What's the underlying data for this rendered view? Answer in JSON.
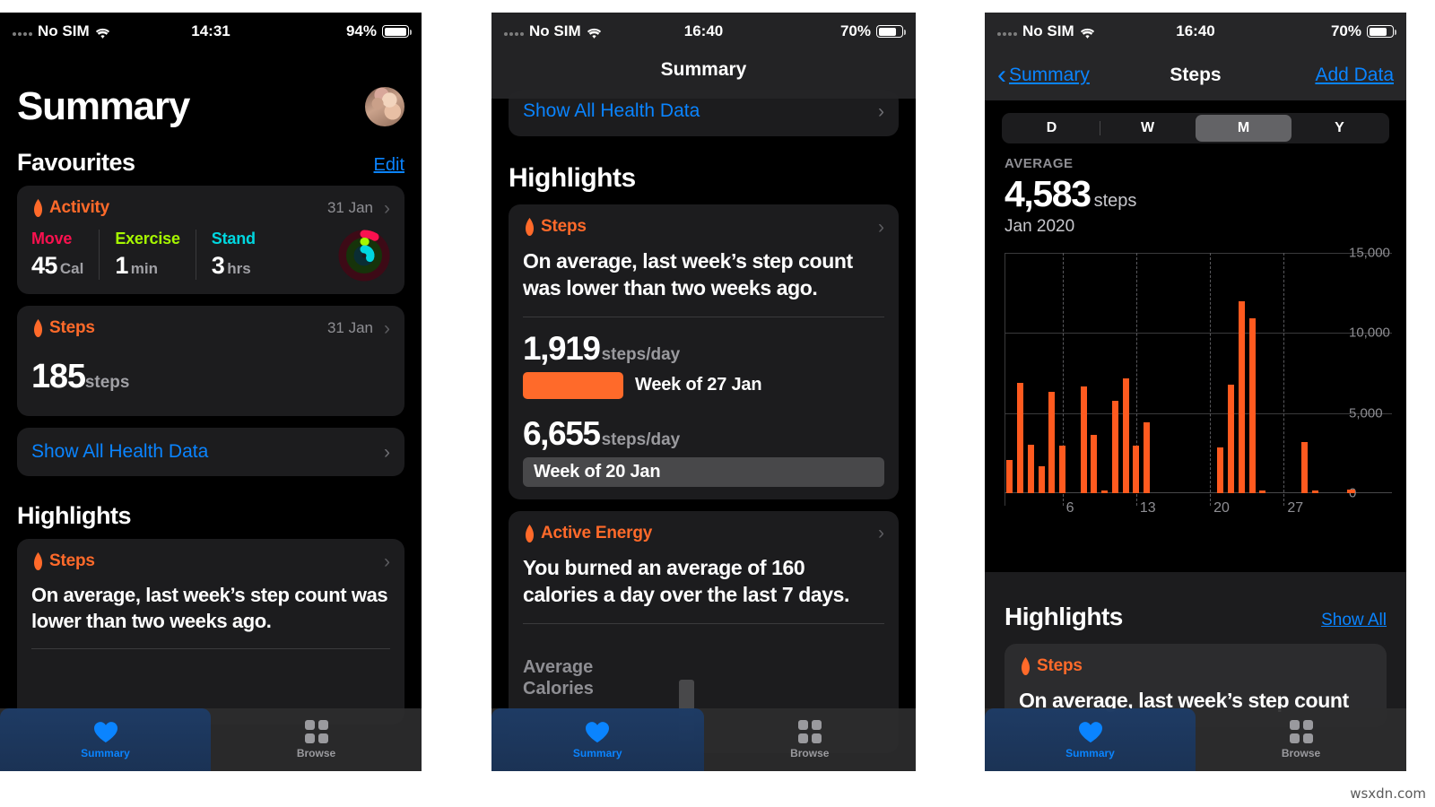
{
  "watermark": "wsxdn.com",
  "panel1": {
    "status": {
      "carrier": "No SIM",
      "time": "14:31",
      "battery": "94%"
    },
    "page_title": "Summary",
    "favourites_label": "Favourites",
    "edit_label": "Edit",
    "activity_card": {
      "title": "Activity",
      "date": "31 Jan",
      "metrics": [
        {
          "label": "Move",
          "value": "45",
          "unit": "Cal",
          "color": "#fa114f"
        },
        {
          "label": "Exercise",
          "value": "1",
          "unit": "min",
          "color": "#a6f700"
        },
        {
          "label": "Stand",
          "value": "3",
          "unit": "hrs",
          "color": "#00d7e0"
        }
      ]
    },
    "steps_card": {
      "title": "Steps",
      "date": "31 Jan",
      "value": "185",
      "unit": "steps"
    },
    "show_all_label": "Show All Health Data",
    "highlights_label": "Highlights",
    "highlight_card": {
      "title": "Steps",
      "body": "On average, last week’s step count was lower than two weeks ago."
    },
    "tabs": [
      {
        "label": "Summary",
        "icon": "heart-icon",
        "selected": true
      },
      {
        "label": "Browse",
        "icon": "grid-icon",
        "selected": false
      }
    ]
  },
  "panel2": {
    "status": {
      "carrier": "No SIM",
      "time": "16:40",
      "battery": "70%"
    },
    "nav_title": "Summary",
    "cut_row_label": "Show All Health Data",
    "highlights_label": "Highlights",
    "steps_card": {
      "title": "Steps",
      "body": "On average, last week’s step count was lower than two weeks ago.",
      "comparison": [
        {
          "value": "1,919",
          "unit": "steps/day",
          "bar_label": "Week of 27 Jan",
          "style": "filled"
        },
        {
          "value": "6,655",
          "unit": "steps/day",
          "bar_label": "Week of 20 Jan",
          "style": "wide"
        }
      ]
    },
    "energy_card": {
      "title": "Active Energy",
      "body": "You burned an average of 160 calories a day over the last 7 days.",
      "axis_label_line1": "Average",
      "axis_label_line2": "Calories"
    },
    "tabs": [
      {
        "label": "Summary",
        "icon": "heart-icon",
        "selected": true
      },
      {
        "label": "Browse",
        "icon": "grid-icon",
        "selected": false
      }
    ]
  },
  "panel3": {
    "status": {
      "carrier": "No SIM",
      "time": "16:40",
      "battery": "70%"
    },
    "back_label": "Summary",
    "nav_title": "Steps",
    "add_data_label": "Add Data",
    "segments": [
      {
        "label": "D",
        "active": false
      },
      {
        "label": "W",
        "active": false
      },
      {
        "label": "M",
        "active": true
      },
      {
        "label": "Y",
        "active": false
      }
    ],
    "average_label": "AVERAGE",
    "average_value": "4,583",
    "average_unit": "steps",
    "period": "Jan 2020",
    "highlights_label": "Highlights",
    "show_all_label": "Show All",
    "highlight_card": {
      "title": "Steps",
      "body": "On average, last week’s step count"
    },
    "tabs": [
      {
        "label": "Summary",
        "icon": "heart-icon",
        "selected": true
      },
      {
        "label": "Browse",
        "icon": "grid-icon",
        "selected": false
      }
    ]
  },
  "chart_data": {
    "type": "bar",
    "title": "Steps",
    "subtitle": "Jan 2020",
    "xlabel": "",
    "ylabel": "steps",
    "ylim": [
      0,
      15000
    ],
    "yticks": [
      0,
      5000,
      10000,
      15000
    ],
    "ytick_labels": [
      "0",
      "5,000",
      "10,000",
      "15,000"
    ],
    "xticks": [
      6,
      13,
      20,
      27
    ],
    "xtick_labels": [
      "6",
      "13",
      "20",
      "27"
    ],
    "grid": true,
    "bar_color": "#ff5a1f",
    "x": [
      1,
      2,
      3,
      4,
      5,
      6,
      7,
      8,
      9,
      10,
      11,
      12,
      13,
      14,
      15,
      16,
      17,
      18,
      19,
      20,
      21,
      22,
      23,
      24,
      25,
      26,
      27,
      28,
      29,
      30,
      31
    ],
    "values": [
      2050,
      6900,
      3000,
      1700,
      6300,
      2950,
      0,
      6650,
      3650,
      100,
      5750,
      7150,
      2950,
      4450,
      0,
      0,
      0,
      0,
      0,
      0,
      2850,
      6750,
      12000,
      10900,
      120,
      0,
      0,
      0,
      3200,
      180,
      0
    ]
  }
}
